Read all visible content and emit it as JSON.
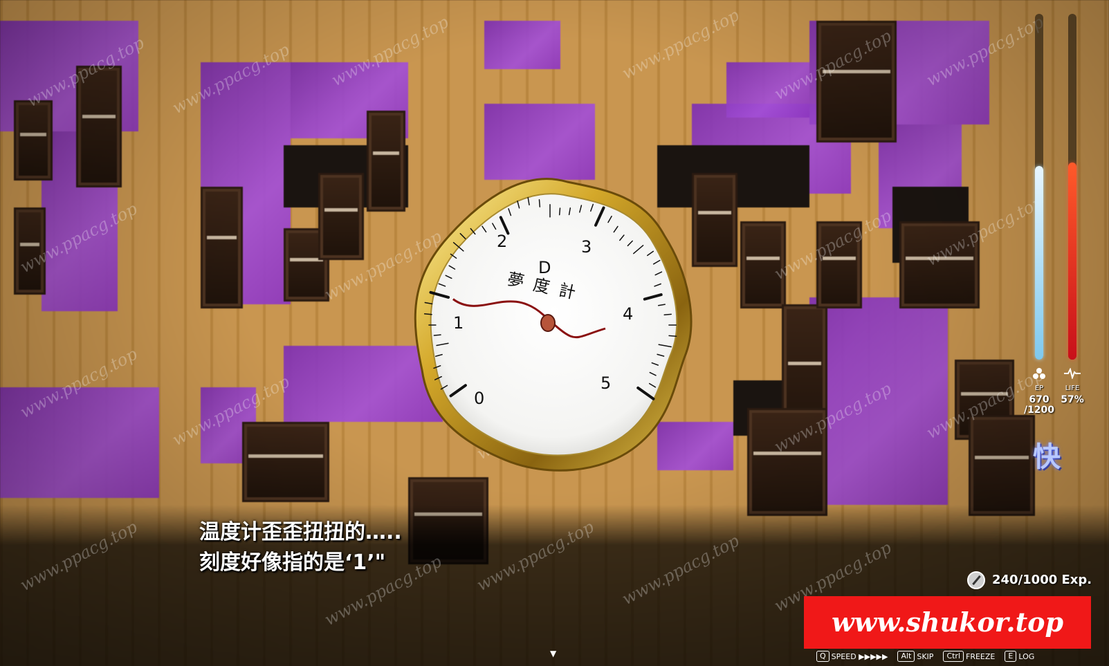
{
  "gauge": {
    "title_top": "D",
    "title": "夢度計",
    "scale": [
      "0",
      "1",
      "2",
      "3",
      "4",
      "5"
    ],
    "reading": 1
  },
  "dialog": {
    "line1": "温度计歪歪扭扭的…..",
    "line2": "刻度好像指的是‘1’\"",
    "cursor": "▼"
  },
  "meters": {
    "ep": {
      "icon": "ep-icon",
      "label": "EP",
      "value": "670",
      "max": "/1200",
      "level": 0.56
    },
    "life": {
      "icon": "heartbeat-icon",
      "label": "LIFE",
      "value": "57%",
      "level": 0.57
    }
  },
  "status_kanji": "快",
  "exp": {
    "icon": "compass-icon",
    "text": "240/1000 Exp."
  },
  "watermark": {
    "text": "www.ppacg.top"
  },
  "banner": {
    "text": "www.shukor.top"
  },
  "hotkeys": [
    {
      "key": "Q",
      "label": "SPEED ▶▶▶▶▶"
    },
    {
      "key": "Alt",
      "label": "SKIP"
    },
    {
      "key": "Ctrl",
      "label": "FREEZE"
    },
    {
      "key": "E",
      "label": "LOG"
    }
  ],
  "colors": {
    "ep": "#7ec9ee",
    "life": "#d81a20",
    "banner": "#f01818",
    "floor": "#c18d47",
    "purple": "#9a45cc"
  }
}
